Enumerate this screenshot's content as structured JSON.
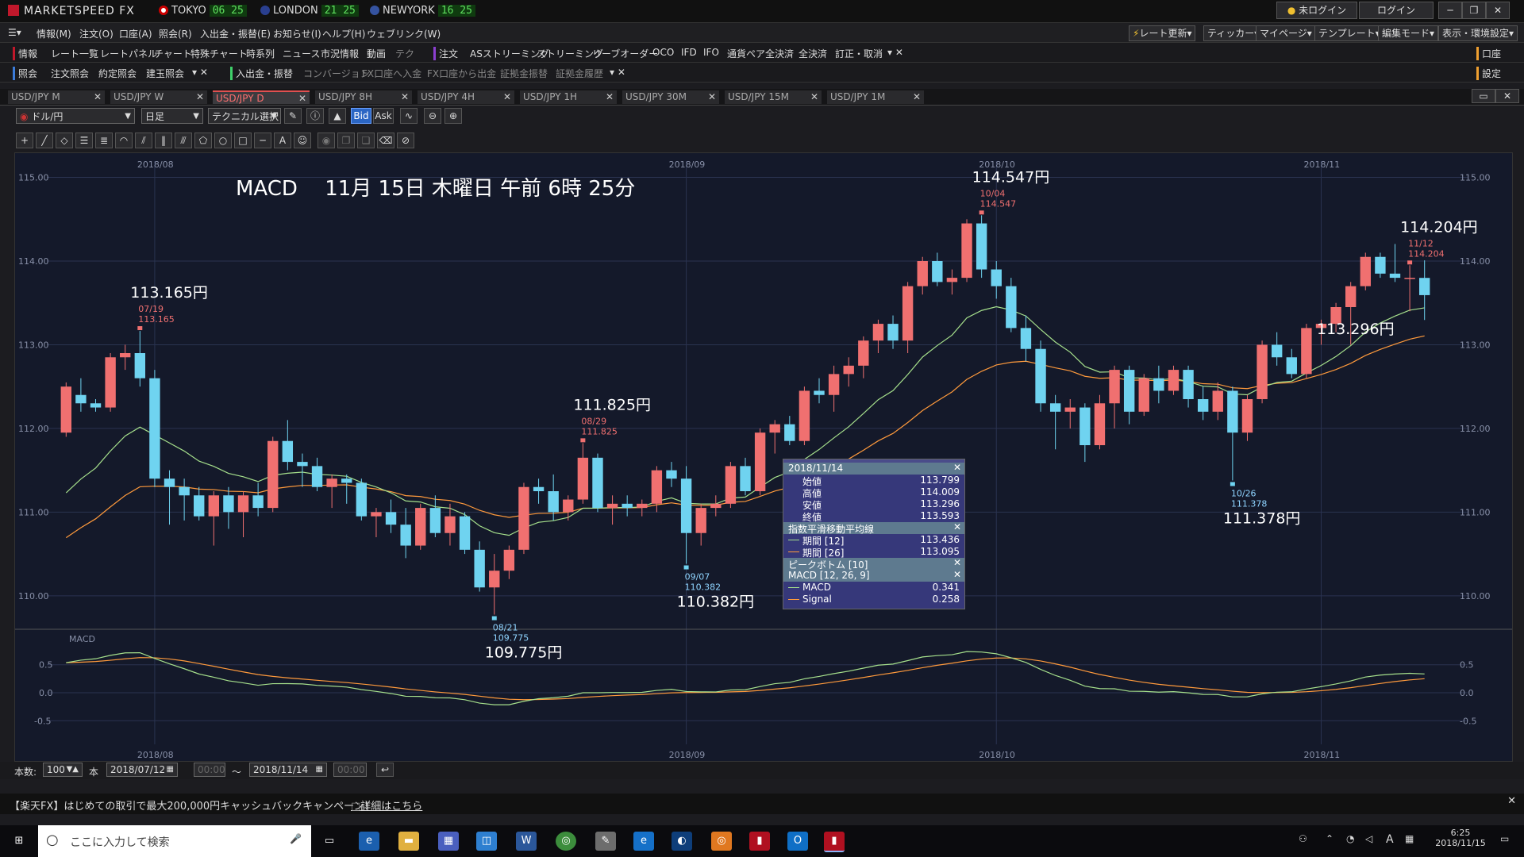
{
  "titlebar": {
    "app": "MARKETSPEED FX",
    "clocks": [
      {
        "city": "TOKYO",
        "time": "06 25"
      },
      {
        "city": "LONDON",
        "time": "21 25"
      },
      {
        "city": "NEWYORK",
        "time": "16 25"
      }
    ],
    "login_status": "未ログイン",
    "login_button": "ログイン"
  },
  "menu": [
    "情報(M)",
    "注文(O)",
    "口座(A)",
    "照会(R)",
    "入出金・振替(E)",
    "お知らせ(I)",
    "ヘルプ(H)",
    "ウェブリンク(W)"
  ],
  "menu_right": [
    "レート更新",
    "ティッカー",
    "マイページ",
    "テンプレート",
    "編集モード",
    "表示・環境設定"
  ],
  "toolbar1": {
    "section": "情報",
    "items": [
      "レート一覧",
      "レートパネル",
      "チャート",
      "特殊チャート",
      "時系列",
      "ニュース",
      "市況情報",
      "動画",
      "テク"
    ],
    "order_section": "注文",
    "order_items": [
      "ASストリーミング",
      "ストリーミング",
      "リーブオーダー",
      "OCO",
      "IFD",
      "IFO",
      "通貨ペア全決済",
      "全決済",
      "訂正・取消"
    ],
    "right_label": "口座"
  },
  "toolbar2": {
    "section": "照会",
    "items": [
      "注文照会",
      "約定照会",
      "建玉照会"
    ],
    "cash_section": "入出金・振替",
    "cash_items": [
      "コンバージョン",
      "FX口座へ入金",
      "FX口座から出金",
      "証拠金振替",
      "証拠金履歴"
    ],
    "right_label": "設定"
  },
  "tabs": [
    {
      "label": "USD/JPY M",
      "active": false
    },
    {
      "label": "USD/JPY W",
      "active": false
    },
    {
      "label": "USD/JPY D",
      "active": true
    },
    {
      "label": "USD/JPY 8H",
      "active": false
    },
    {
      "label": "USD/JPY 4H",
      "active": false
    },
    {
      "label": "USD/JPY 1H",
      "active": false
    },
    {
      "label": "USD/JPY 30M",
      "active": false
    },
    {
      "label": "USD/JPY 15M",
      "active": false
    },
    {
      "label": "USD/JPY 1M",
      "active": false
    }
  ],
  "controls": {
    "pair": "ドル/円",
    "period": "日足",
    "technical": "テクニカル選択",
    "bid": "Bid",
    "ask": "Ask"
  },
  "chart_header": "MACD　 11月 15日 木曜日 午前 6時 25分",
  "chart_data": {
    "type": "candlestick",
    "xlabels": [
      "2018/08",
      "2018/09",
      "2018/10",
      "2018/11"
    ],
    "ylabels": [
      "115.00",
      "114.00",
      "113.00",
      "112.00",
      "111.00",
      "110.00"
    ],
    "ylim": [
      109.6,
      115.1
    ],
    "candles": [
      {
        "o": 111.95,
        "h": 112.55,
        "l": 111.9,
        "c": 112.5
      },
      {
        "o": 112.4,
        "h": 112.6,
        "l": 112.2,
        "c": 112.3
      },
      {
        "o": 112.3,
        "h": 112.35,
        "l": 112.2,
        "c": 112.25
      },
      {
        "o": 112.25,
        "h": 112.9,
        "l": 112.2,
        "c": 112.85
      },
      {
        "o": 112.85,
        "h": 113.0,
        "l": 112.7,
        "c": 112.9
      },
      {
        "o": 112.9,
        "h": 113.165,
        "l": 112.5,
        "c": 112.6
      },
      {
        "o": 112.6,
        "h": 112.7,
        "l": 111.3,
        "c": 111.4
      },
      {
        "o": 111.4,
        "h": 111.5,
        "l": 110.85,
        "c": 111.3
      },
      {
        "o": 111.3,
        "h": 111.4,
        "l": 110.9,
        "c": 111.2
      },
      {
        "o": 111.2,
        "h": 111.3,
        "l": 110.9,
        "c": 110.95
      },
      {
        "o": 110.95,
        "h": 111.25,
        "l": 110.6,
        "c": 111.2
      },
      {
        "o": 111.2,
        "h": 111.3,
        "l": 110.8,
        "c": 111.0
      },
      {
        "o": 111.0,
        "h": 111.25,
        "l": 110.7,
        "c": 111.2
      },
      {
        "o": 111.2,
        "h": 111.35,
        "l": 110.95,
        "c": 111.05
      },
      {
        "o": 111.05,
        "h": 111.9,
        "l": 111.0,
        "c": 111.85
      },
      {
        "o": 111.85,
        "h": 112.1,
        "l": 111.5,
        "c": 111.6
      },
      {
        "o": 111.6,
        "h": 111.7,
        "l": 111.3,
        "c": 111.55
      },
      {
        "o": 111.55,
        "h": 111.65,
        "l": 111.25,
        "c": 111.3
      },
      {
        "o": 111.3,
        "h": 111.45,
        "l": 111.05,
        "c": 111.4
      },
      {
        "o": 111.4,
        "h": 111.45,
        "l": 111.1,
        "c": 111.35
      },
      {
        "o": 111.35,
        "h": 111.4,
        "l": 110.9,
        "c": 110.95
      },
      {
        "o": 110.95,
        "h": 111.05,
        "l": 110.7,
        "c": 111.0
      },
      {
        "o": 111.0,
        "h": 111.15,
        "l": 110.75,
        "c": 110.85
      },
      {
        "o": 110.85,
        "h": 111.05,
        "l": 110.45,
        "c": 110.6
      },
      {
        "o": 110.6,
        "h": 111.1,
        "l": 110.55,
        "c": 111.05
      },
      {
        "o": 111.05,
        "h": 111.2,
        "l": 110.7,
        "c": 110.75
      },
      {
        "o": 110.75,
        "h": 111.1,
        "l": 110.6,
        "c": 110.95
      },
      {
        "o": 110.95,
        "h": 111.0,
        "l": 110.5,
        "c": 110.55
      },
      {
        "o": 110.55,
        "h": 110.65,
        "l": 110.05,
        "c": 110.1
      },
      {
        "o": 110.1,
        "h": 110.5,
        "l": 109.775,
        "c": 110.3
      },
      {
        "o": 110.3,
        "h": 110.6,
        "l": 110.2,
        "c": 110.55
      },
      {
        "o": 110.55,
        "h": 111.35,
        "l": 110.5,
        "c": 111.3
      },
      {
        "o": 111.3,
        "h": 111.4,
        "l": 111.1,
        "c": 111.25
      },
      {
        "o": 111.25,
        "h": 111.45,
        "l": 110.9,
        "c": 111.0
      },
      {
        "o": 111.0,
        "h": 111.2,
        "l": 110.9,
        "c": 111.15
      },
      {
        "o": 111.15,
        "h": 111.825,
        "l": 111.1,
        "c": 111.65
      },
      {
        "o": 111.65,
        "h": 111.7,
        "l": 111.0,
        "c": 111.05
      },
      {
        "o": 111.05,
        "h": 111.2,
        "l": 110.85,
        "c": 111.1
      },
      {
        "o": 111.1,
        "h": 111.2,
        "l": 110.95,
        "c": 111.05
      },
      {
        "o": 111.05,
        "h": 111.15,
        "l": 110.95,
        "c": 111.1
      },
      {
        "o": 111.1,
        "h": 111.55,
        "l": 111.0,
        "c": 111.5
      },
      {
        "o": 111.5,
        "h": 111.6,
        "l": 111.3,
        "c": 111.4
      },
      {
        "o": 111.4,
        "h": 111.55,
        "l": 110.382,
        "c": 110.75
      },
      {
        "o": 110.75,
        "h": 111.1,
        "l": 110.6,
        "c": 111.05
      },
      {
        "o": 111.05,
        "h": 111.2,
        "l": 110.95,
        "c": 111.1
      },
      {
        "o": 111.1,
        "h": 111.6,
        "l": 111.05,
        "c": 111.55
      },
      {
        "o": 111.55,
        "h": 111.65,
        "l": 111.2,
        "c": 111.25
      },
      {
        "o": 111.25,
        "h": 112.0,
        "l": 111.2,
        "c": 111.95
      },
      {
        "o": 111.95,
        "h": 112.1,
        "l": 111.7,
        "c": 112.05
      },
      {
        "o": 112.05,
        "h": 112.15,
        "l": 111.8,
        "c": 111.85
      },
      {
        "o": 111.85,
        "h": 112.5,
        "l": 111.8,
        "c": 112.45
      },
      {
        "o": 112.45,
        "h": 112.6,
        "l": 112.3,
        "c": 112.4
      },
      {
        "o": 112.4,
        "h": 112.75,
        "l": 112.2,
        "c": 112.65
      },
      {
        "o": 112.65,
        "h": 112.85,
        "l": 112.5,
        "c": 112.75
      },
      {
        "o": 112.75,
        "h": 113.1,
        "l": 112.6,
        "c": 113.05
      },
      {
        "o": 113.05,
        "h": 113.3,
        "l": 112.9,
        "c": 113.25
      },
      {
        "o": 113.25,
        "h": 113.35,
        "l": 112.95,
        "c": 113.05
      },
      {
        "o": 113.05,
        "h": 113.75,
        "l": 112.9,
        "c": 113.7
      },
      {
        "o": 113.7,
        "h": 114.05,
        "l": 113.6,
        "c": 114.0
      },
      {
        "o": 114.0,
        "h": 114.1,
        "l": 113.7,
        "c": 113.75
      },
      {
        "o": 113.75,
        "h": 113.9,
        "l": 113.6,
        "c": 113.8
      },
      {
        "o": 113.8,
        "h": 114.5,
        "l": 113.75,
        "c": 114.45
      },
      {
        "o": 114.45,
        "h": 114.547,
        "l": 113.8,
        "c": 113.9
      },
      {
        "o": 113.9,
        "h": 114.0,
        "l": 113.55,
        "c": 113.7
      },
      {
        "o": 113.7,
        "h": 113.8,
        "l": 113.15,
        "c": 113.2
      },
      {
        "o": 113.2,
        "h": 113.35,
        "l": 112.8,
        "c": 112.95
      },
      {
        "o": 112.95,
        "h": 113.05,
        "l": 112.2,
        "c": 112.3
      },
      {
        "o": 112.3,
        "h": 112.4,
        "l": 111.75,
        "c": 112.2
      },
      {
        "o": 112.2,
        "h": 112.35,
        "l": 112.0,
        "c": 112.25
      },
      {
        "o": 112.25,
        "h": 112.3,
        "l": 111.6,
        "c": 111.8
      },
      {
        "o": 111.8,
        "h": 112.4,
        "l": 111.75,
        "c": 112.3
      },
      {
        "o": 112.3,
        "h": 112.75,
        "l": 112.0,
        "c": 112.7
      },
      {
        "o": 112.7,
        "h": 112.75,
        "l": 112.05,
        "c": 112.2
      },
      {
        "o": 112.2,
        "h": 112.65,
        "l": 112.15,
        "c": 112.6
      },
      {
        "o": 112.6,
        "h": 112.75,
        "l": 112.3,
        "c": 112.45
      },
      {
        "o": 112.45,
        "h": 112.75,
        "l": 112.4,
        "c": 112.7
      },
      {
        "o": 112.7,
        "h": 112.75,
        "l": 112.25,
        "c": 112.35
      },
      {
        "o": 112.35,
        "h": 112.5,
        "l": 112.1,
        "c": 112.2
      },
      {
        "o": 112.2,
        "h": 112.55,
        "l": 112.1,
        "c": 112.45
      },
      {
        "o": 112.45,
        "h": 112.5,
        "l": 111.378,
        "c": 111.95
      },
      {
        "o": 111.95,
        "h": 112.4,
        "l": 111.85,
        "c": 112.35
      },
      {
        "o": 112.35,
        "h": 113.05,
        "l": 112.3,
        "c": 113.0
      },
      {
        "o": 113.0,
        "h": 113.15,
        "l": 112.75,
        "c": 112.85
      },
      {
        "o": 112.85,
        "h": 112.95,
        "l": 112.6,
        "c": 112.65
      },
      {
        "o": 112.65,
        "h": 113.25,
        "l": 112.6,
        "c": 113.2
      },
      {
        "o": 113.2,
        "h": 113.3,
        "l": 113.0,
        "c": 113.25
      },
      {
        "o": 113.25,
        "h": 113.5,
        "l": 113.15,
        "c": 113.45
      },
      {
        "o": 113.45,
        "h": 113.75,
        "l": 113.0,
        "c": 113.7
      },
      {
        "o": 113.7,
        "h": 114.1,
        "l": 113.65,
        "c": 114.05
      },
      {
        "o": 114.05,
        "h": 114.1,
        "l": 113.8,
        "c": 113.85
      },
      {
        "o": 113.85,
        "h": 114.204,
        "l": 113.75,
        "c": 113.8
      },
      {
        "o": 113.8,
        "h": 113.95,
        "l": 113.4,
        "c": 113.8
      },
      {
        "o": 113.799,
        "h": 114.009,
        "l": 113.296,
        "c": 113.593
      }
    ],
    "ema12_start": 111.0,
    "ema26_start": 110.55,
    "annotations": [
      {
        "i": 5,
        "date": "07/19",
        "price": "113.165",
        "big": "113.165円",
        "kind": "high"
      },
      {
        "i": 29,
        "date": "08/21",
        "price": "109.775",
        "big": "109.775円",
        "kind": "low"
      },
      {
        "i": 35,
        "date": "08/29",
        "price": "111.825",
        "big": "111.825円",
        "kind": "high"
      },
      {
        "i": 42,
        "date": "09/07",
        "price": "110.382",
        "big": "110.382円",
        "kind": "low"
      },
      {
        "i": 62,
        "date": "10/04",
        "price": "114.547",
        "big": "114.547円",
        "kind": "high"
      },
      {
        "i": 79,
        "date": "10/26",
        "price": "111.378",
        "big": "111.378円",
        "kind": "low"
      },
      {
        "i": 91,
        "date": "11/12",
        "price": "114.204",
        "big": "114.204円",
        "kind": "high"
      }
    ],
    "right_label": "113.296円",
    "macd_label": "MACD",
    "macd_ylabels": [
      "0.5",
      "0.0",
      "-0.5"
    ]
  },
  "infobox": {
    "date": "2018/11/14",
    "rows": [
      {
        "k": "始値",
        "v": "113.799"
      },
      {
        "k": "高値",
        "v": "114.009"
      },
      {
        "k": "安値",
        "v": "113.296"
      },
      {
        "k": "終値",
        "v": "113.593"
      }
    ],
    "ema_title": "指数平滑移動平均線",
    "ema_rows": [
      {
        "k": "期間 [12]",
        "v": "113.436",
        "color": "#a6e08c"
      },
      {
        "k": "期間 [26]",
        "v": "113.095",
        "color": "#ff9a3c"
      }
    ],
    "peak_title": "ピークボトム [10]",
    "macd_title": "MACD [12, 26, 9]",
    "macd_rows": [
      {
        "k": "MACD",
        "v": "0.341",
        "color": "#a6e08c"
      },
      {
        "k": "Signal",
        "v": "0.258",
        "color": "#ff9a3c"
      }
    ]
  },
  "bottombar": {
    "count_label": "本数:",
    "count": "100",
    "unit": "本",
    "from": "2018/07/12",
    "from_time": "00:00",
    "tilde": "～",
    "to": "2018/11/14",
    "to_time": "00:00"
  },
  "banner": {
    "text": "【楽天FX】はじめての取引で最大200,000円キャッシュバックキャンペーン！",
    "link": "詳細はこちら"
  },
  "taskbar": {
    "search_placeholder": "ここに入力して検索",
    "time": "6:25",
    "date": "2018/11/15",
    "ime": "A"
  },
  "colors": {
    "up": "#f07070",
    "down": "#6fd3f0",
    "ema12": "#a6e08c",
    "ema26": "#ff9a3c",
    "grid": "#2a3350"
  }
}
